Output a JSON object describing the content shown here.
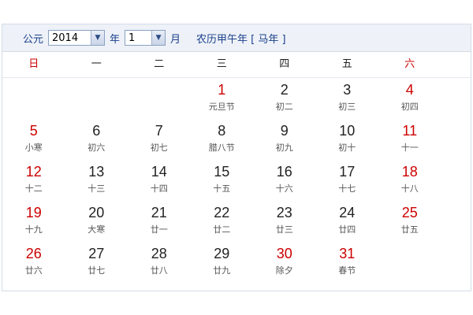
{
  "header": {
    "era_label": "公元",
    "year_value": "2014",
    "year_label": "年",
    "month_value": "1",
    "month_label": "月",
    "lunar_info": "农历甲午年 [ 马年 ]"
  },
  "weekdays": [
    "日",
    "一",
    "二",
    "三",
    "四",
    "五",
    "六"
  ],
  "colors": {
    "holiday": "#cc0000",
    "accent": "#1a3f8c"
  },
  "weeks": [
    [
      {
        "day": "",
        "lunar": "",
        "red": false
      },
      {
        "day": "",
        "lunar": "",
        "red": false
      },
      {
        "day": "",
        "lunar": "",
        "red": false
      },
      {
        "day": "1",
        "lunar": "元旦节",
        "red": true
      },
      {
        "day": "2",
        "lunar": "初二",
        "red": false
      },
      {
        "day": "3",
        "lunar": "初三",
        "red": false
      },
      {
        "day": "4",
        "lunar": "初四",
        "red": true
      }
    ],
    [
      {
        "day": "5",
        "lunar": "小寒",
        "red": true
      },
      {
        "day": "6",
        "lunar": "初六",
        "red": false
      },
      {
        "day": "7",
        "lunar": "初七",
        "red": false
      },
      {
        "day": "8",
        "lunar": "腊八节",
        "red": false
      },
      {
        "day": "9",
        "lunar": "初九",
        "red": false
      },
      {
        "day": "10",
        "lunar": "初十",
        "red": false
      },
      {
        "day": "11",
        "lunar": "十一",
        "red": true
      }
    ],
    [
      {
        "day": "12",
        "lunar": "十二",
        "red": true
      },
      {
        "day": "13",
        "lunar": "十三",
        "red": false
      },
      {
        "day": "14",
        "lunar": "十四",
        "red": false
      },
      {
        "day": "15",
        "lunar": "十五",
        "red": false
      },
      {
        "day": "16",
        "lunar": "十六",
        "red": false
      },
      {
        "day": "17",
        "lunar": "十七",
        "red": false
      },
      {
        "day": "18",
        "lunar": "十八",
        "red": true
      }
    ],
    [
      {
        "day": "19",
        "lunar": "十九",
        "red": true
      },
      {
        "day": "20",
        "lunar": "大寒",
        "red": false
      },
      {
        "day": "21",
        "lunar": "廿一",
        "red": false
      },
      {
        "day": "22",
        "lunar": "廿二",
        "red": false
      },
      {
        "day": "23",
        "lunar": "廿三",
        "red": false
      },
      {
        "day": "24",
        "lunar": "廿四",
        "red": false
      },
      {
        "day": "25",
        "lunar": "廿五",
        "red": true
      }
    ],
    [
      {
        "day": "26",
        "lunar": "廿六",
        "red": true
      },
      {
        "day": "27",
        "lunar": "廿七",
        "red": false
      },
      {
        "day": "28",
        "lunar": "廿八",
        "red": false
      },
      {
        "day": "29",
        "lunar": "廿九",
        "red": false
      },
      {
        "day": "30",
        "lunar": "除夕",
        "red": true
      },
      {
        "day": "31",
        "lunar": "春节",
        "red": true
      },
      {
        "day": "",
        "lunar": "",
        "red": false
      }
    ]
  ]
}
